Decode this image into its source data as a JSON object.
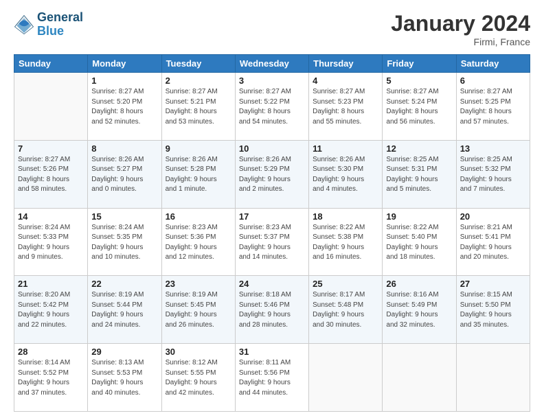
{
  "header": {
    "logo_line1": "General",
    "logo_line2": "Blue",
    "month": "January 2024",
    "location": "Firmi, France"
  },
  "days_of_week": [
    "Sunday",
    "Monday",
    "Tuesday",
    "Wednesday",
    "Thursday",
    "Friday",
    "Saturday"
  ],
  "weeks": [
    [
      {
        "day": "",
        "info": ""
      },
      {
        "day": "1",
        "info": "Sunrise: 8:27 AM\nSunset: 5:20 PM\nDaylight: 8 hours\nand 52 minutes."
      },
      {
        "day": "2",
        "info": "Sunrise: 8:27 AM\nSunset: 5:21 PM\nDaylight: 8 hours\nand 53 minutes."
      },
      {
        "day": "3",
        "info": "Sunrise: 8:27 AM\nSunset: 5:22 PM\nDaylight: 8 hours\nand 54 minutes."
      },
      {
        "day": "4",
        "info": "Sunrise: 8:27 AM\nSunset: 5:23 PM\nDaylight: 8 hours\nand 55 minutes."
      },
      {
        "day": "5",
        "info": "Sunrise: 8:27 AM\nSunset: 5:24 PM\nDaylight: 8 hours\nand 56 minutes."
      },
      {
        "day": "6",
        "info": "Sunrise: 8:27 AM\nSunset: 5:25 PM\nDaylight: 8 hours\nand 57 minutes."
      }
    ],
    [
      {
        "day": "7",
        "info": "Sunrise: 8:27 AM\nSunset: 5:26 PM\nDaylight: 8 hours\nand 58 minutes."
      },
      {
        "day": "8",
        "info": "Sunrise: 8:26 AM\nSunset: 5:27 PM\nDaylight: 9 hours\nand 0 minutes."
      },
      {
        "day": "9",
        "info": "Sunrise: 8:26 AM\nSunset: 5:28 PM\nDaylight: 9 hours\nand 1 minute."
      },
      {
        "day": "10",
        "info": "Sunrise: 8:26 AM\nSunset: 5:29 PM\nDaylight: 9 hours\nand 2 minutes."
      },
      {
        "day": "11",
        "info": "Sunrise: 8:26 AM\nSunset: 5:30 PM\nDaylight: 9 hours\nand 4 minutes."
      },
      {
        "day": "12",
        "info": "Sunrise: 8:25 AM\nSunset: 5:31 PM\nDaylight: 9 hours\nand 5 minutes."
      },
      {
        "day": "13",
        "info": "Sunrise: 8:25 AM\nSunset: 5:32 PM\nDaylight: 9 hours\nand 7 minutes."
      }
    ],
    [
      {
        "day": "14",
        "info": "Sunrise: 8:24 AM\nSunset: 5:33 PM\nDaylight: 9 hours\nand 9 minutes."
      },
      {
        "day": "15",
        "info": "Sunrise: 8:24 AM\nSunset: 5:35 PM\nDaylight: 9 hours\nand 10 minutes."
      },
      {
        "day": "16",
        "info": "Sunrise: 8:23 AM\nSunset: 5:36 PM\nDaylight: 9 hours\nand 12 minutes."
      },
      {
        "day": "17",
        "info": "Sunrise: 8:23 AM\nSunset: 5:37 PM\nDaylight: 9 hours\nand 14 minutes."
      },
      {
        "day": "18",
        "info": "Sunrise: 8:22 AM\nSunset: 5:38 PM\nDaylight: 9 hours\nand 16 minutes."
      },
      {
        "day": "19",
        "info": "Sunrise: 8:22 AM\nSunset: 5:40 PM\nDaylight: 9 hours\nand 18 minutes."
      },
      {
        "day": "20",
        "info": "Sunrise: 8:21 AM\nSunset: 5:41 PM\nDaylight: 9 hours\nand 20 minutes."
      }
    ],
    [
      {
        "day": "21",
        "info": "Sunrise: 8:20 AM\nSunset: 5:42 PM\nDaylight: 9 hours\nand 22 minutes."
      },
      {
        "day": "22",
        "info": "Sunrise: 8:19 AM\nSunset: 5:44 PM\nDaylight: 9 hours\nand 24 minutes."
      },
      {
        "day": "23",
        "info": "Sunrise: 8:19 AM\nSunset: 5:45 PM\nDaylight: 9 hours\nand 26 minutes."
      },
      {
        "day": "24",
        "info": "Sunrise: 8:18 AM\nSunset: 5:46 PM\nDaylight: 9 hours\nand 28 minutes."
      },
      {
        "day": "25",
        "info": "Sunrise: 8:17 AM\nSunset: 5:48 PM\nDaylight: 9 hours\nand 30 minutes."
      },
      {
        "day": "26",
        "info": "Sunrise: 8:16 AM\nSunset: 5:49 PM\nDaylight: 9 hours\nand 32 minutes."
      },
      {
        "day": "27",
        "info": "Sunrise: 8:15 AM\nSunset: 5:50 PM\nDaylight: 9 hours\nand 35 minutes."
      }
    ],
    [
      {
        "day": "28",
        "info": "Sunrise: 8:14 AM\nSunset: 5:52 PM\nDaylight: 9 hours\nand 37 minutes."
      },
      {
        "day": "29",
        "info": "Sunrise: 8:13 AM\nSunset: 5:53 PM\nDaylight: 9 hours\nand 40 minutes."
      },
      {
        "day": "30",
        "info": "Sunrise: 8:12 AM\nSunset: 5:55 PM\nDaylight: 9 hours\nand 42 minutes."
      },
      {
        "day": "31",
        "info": "Sunrise: 8:11 AM\nSunset: 5:56 PM\nDaylight: 9 hours\nand 44 minutes."
      },
      {
        "day": "",
        "info": ""
      },
      {
        "day": "",
        "info": ""
      },
      {
        "day": "",
        "info": ""
      }
    ]
  ]
}
